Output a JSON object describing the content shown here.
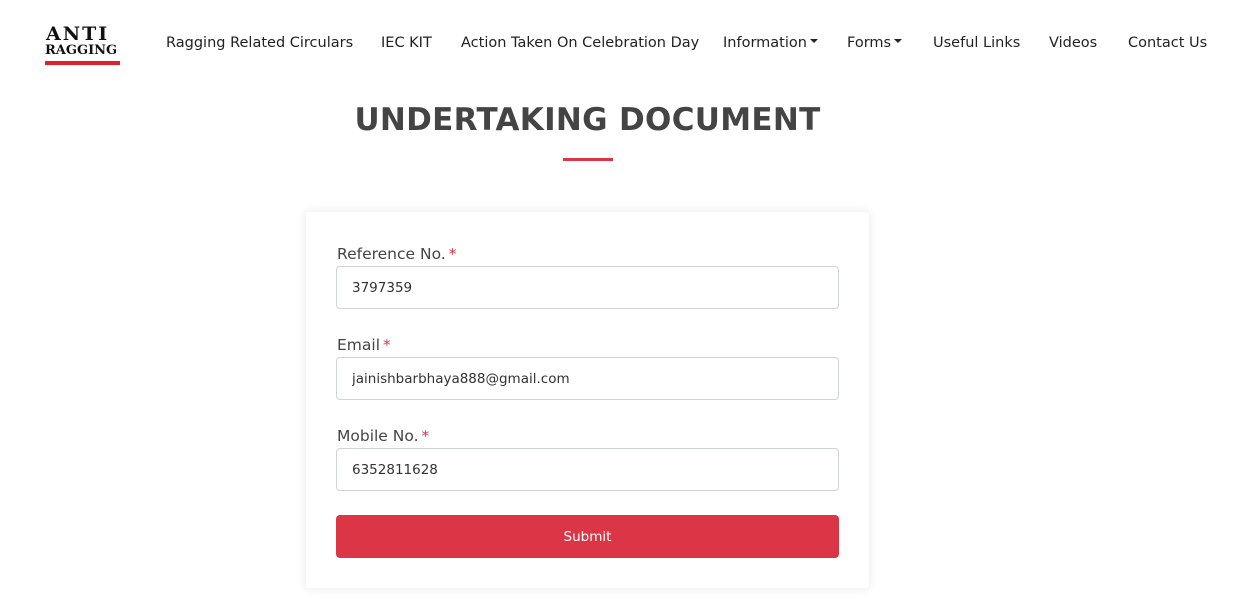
{
  "logo": {
    "line1": "ANTI",
    "line2": "RAGGING",
    "accent_color": "#e0202c"
  },
  "nav": {
    "items": [
      {
        "label": "Ragging Related Circulars",
        "dropdown": false
      },
      {
        "label": "IEC KIT",
        "dropdown": false
      },
      {
        "label": "Action Taken On Celebration Day",
        "dropdown": false
      },
      {
        "label": "Information",
        "dropdown": true
      },
      {
        "label": "Forms",
        "dropdown": true
      },
      {
        "label": "Useful Links",
        "dropdown": false
      },
      {
        "label": "Videos",
        "dropdown": false
      },
      {
        "label": "Contact Us",
        "dropdown": false
      }
    ]
  },
  "page": {
    "title": "UNDERTAKING DOCUMENT"
  },
  "form": {
    "reference": {
      "label": "Reference No.",
      "required_mark": "*",
      "value": "3797359"
    },
    "email": {
      "label": "Email",
      "required_mark": "*",
      "value": "jainishbarbhaya888@gmail.com"
    },
    "mobile": {
      "label": "Mobile No.",
      "required_mark": "*",
      "value": "6352811628"
    },
    "submit_label": "Submit"
  },
  "colors": {
    "accent": "#dc3545",
    "text": "#444444"
  }
}
